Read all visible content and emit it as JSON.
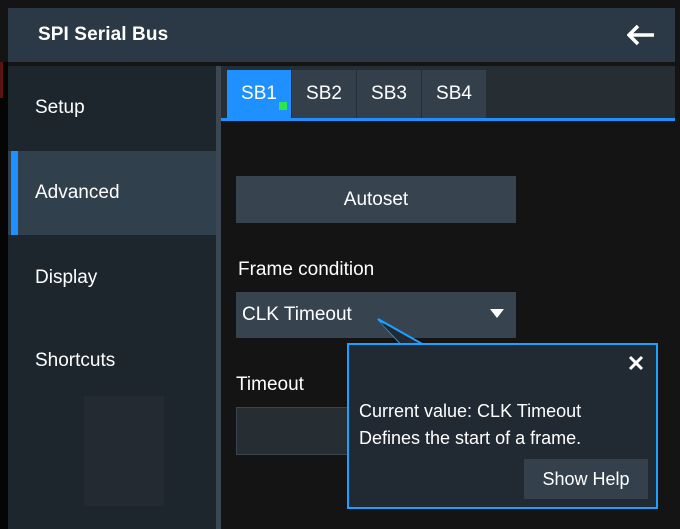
{
  "window": {
    "title": "SPI Serial Bus",
    "back_icon": "arrow-left-icon"
  },
  "sidebar": {
    "items": [
      {
        "label": "Setup",
        "active": false
      },
      {
        "label": "Advanced",
        "active": true
      },
      {
        "label": "Display",
        "active": false
      },
      {
        "label": "Shortcuts",
        "active": false
      }
    ]
  },
  "tabs": [
    {
      "label": "SB1",
      "active": true,
      "indicator_color": "#2ee64c"
    },
    {
      "label": "SB2",
      "active": false
    },
    {
      "label": "SB3",
      "active": false
    },
    {
      "label": "SB4",
      "active": false
    }
  ],
  "main": {
    "autoset_label": "Autoset",
    "frame_condition": {
      "label": "Frame condition",
      "value": "CLK Timeout",
      "caret_icon": "caret-down-icon"
    },
    "timeout": {
      "label": "Timeout",
      "value": ""
    }
  },
  "tooltip": {
    "close_icon": "close-icon",
    "line1": "Current value: CLK Timeout",
    "line2": "Defines the start of a frame.",
    "help_label": "Show Help"
  },
  "colors": {
    "accent": "#1e90ff",
    "tooltip_border": "#1ea0ff",
    "title_bar": "#2b3946",
    "sidebar_active": "#30404d",
    "active_indicator": "#2ee64c"
  }
}
